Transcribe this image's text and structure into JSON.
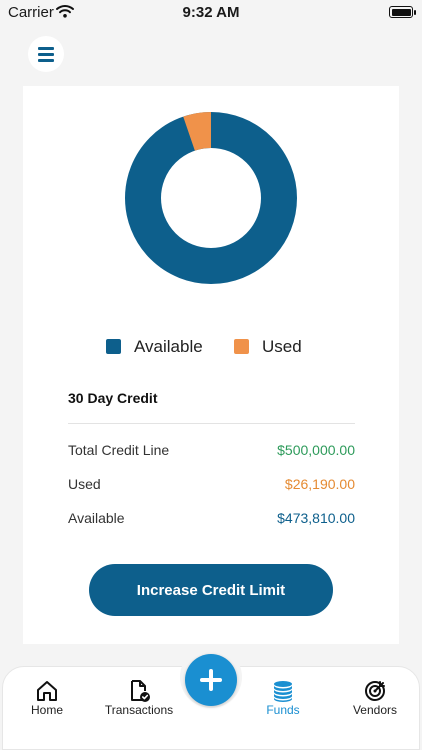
{
  "status_bar": {
    "carrier": "Carrier",
    "time": "9:32 AM"
  },
  "chart": {
    "available_amount": 473810,
    "used_amount": 26190,
    "available_color": "#0d5f8c",
    "used_color": "#f0924a"
  },
  "legend": [
    {
      "label": "Available",
      "color": "#0d5f8c"
    },
    {
      "label": "Used",
      "color": "#f0924a"
    }
  ],
  "credit": {
    "title": "30 Day Credit",
    "rows": [
      {
        "label": "Total Credit Line",
        "value": "$500,000.00",
        "color": "#2e9b5b"
      },
      {
        "label": "Used",
        "value": "$26,190.00",
        "color": "#e58b33"
      },
      {
        "label": "Available",
        "value": "$473,810.00",
        "color": "#0d5f8c"
      }
    ]
  },
  "cta_label": "Increase Credit Limit",
  "tabs": [
    {
      "label": "Home",
      "icon": "home-icon",
      "active": false
    },
    {
      "label": "Transactions",
      "icon": "document-check-icon",
      "active": false
    },
    {
      "label": "Funds",
      "icon": "coins-icon",
      "active": true
    },
    {
      "label": "Vendors",
      "icon": "target-icon",
      "active": false
    }
  ],
  "colors": {
    "primary": "#0d5f8c",
    "accent": "#1a8fd1",
    "active_tab": "#1a8fd1"
  }
}
